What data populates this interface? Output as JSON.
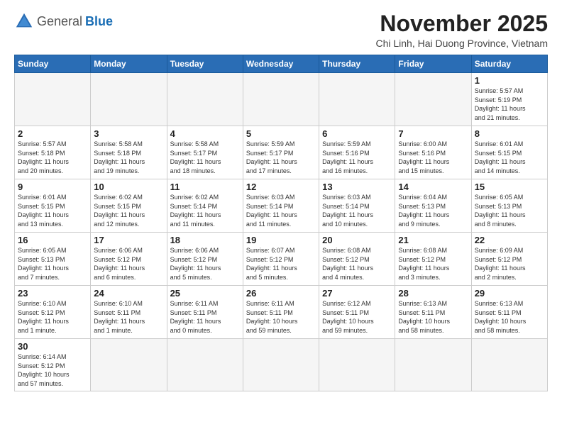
{
  "header": {
    "logo_general": "General",
    "logo_blue": "Blue",
    "month_title": "November 2025",
    "location": "Chi Linh, Hai Duong Province, Vietnam"
  },
  "weekdays": [
    "Sunday",
    "Monday",
    "Tuesday",
    "Wednesday",
    "Thursday",
    "Friday",
    "Saturday"
  ],
  "weeks": [
    [
      {
        "day": "",
        "info": ""
      },
      {
        "day": "",
        "info": ""
      },
      {
        "day": "",
        "info": ""
      },
      {
        "day": "",
        "info": ""
      },
      {
        "day": "",
        "info": ""
      },
      {
        "day": "",
        "info": ""
      },
      {
        "day": "1",
        "info": "Sunrise: 5:57 AM\nSunset: 5:19 PM\nDaylight: 11 hours\nand 21 minutes."
      }
    ],
    [
      {
        "day": "2",
        "info": "Sunrise: 5:57 AM\nSunset: 5:18 PM\nDaylight: 11 hours\nand 20 minutes."
      },
      {
        "day": "3",
        "info": "Sunrise: 5:58 AM\nSunset: 5:18 PM\nDaylight: 11 hours\nand 19 minutes."
      },
      {
        "day": "4",
        "info": "Sunrise: 5:58 AM\nSunset: 5:17 PM\nDaylight: 11 hours\nand 18 minutes."
      },
      {
        "day": "5",
        "info": "Sunrise: 5:59 AM\nSunset: 5:17 PM\nDaylight: 11 hours\nand 17 minutes."
      },
      {
        "day": "6",
        "info": "Sunrise: 5:59 AM\nSunset: 5:16 PM\nDaylight: 11 hours\nand 16 minutes."
      },
      {
        "day": "7",
        "info": "Sunrise: 6:00 AM\nSunset: 5:16 PM\nDaylight: 11 hours\nand 15 minutes."
      },
      {
        "day": "8",
        "info": "Sunrise: 6:01 AM\nSunset: 5:15 PM\nDaylight: 11 hours\nand 14 minutes."
      }
    ],
    [
      {
        "day": "9",
        "info": "Sunrise: 6:01 AM\nSunset: 5:15 PM\nDaylight: 11 hours\nand 13 minutes."
      },
      {
        "day": "10",
        "info": "Sunrise: 6:02 AM\nSunset: 5:15 PM\nDaylight: 11 hours\nand 12 minutes."
      },
      {
        "day": "11",
        "info": "Sunrise: 6:02 AM\nSunset: 5:14 PM\nDaylight: 11 hours\nand 11 minutes."
      },
      {
        "day": "12",
        "info": "Sunrise: 6:03 AM\nSunset: 5:14 PM\nDaylight: 11 hours\nand 11 minutes."
      },
      {
        "day": "13",
        "info": "Sunrise: 6:03 AM\nSunset: 5:14 PM\nDaylight: 11 hours\nand 10 minutes."
      },
      {
        "day": "14",
        "info": "Sunrise: 6:04 AM\nSunset: 5:13 PM\nDaylight: 11 hours\nand 9 minutes."
      },
      {
        "day": "15",
        "info": "Sunrise: 6:05 AM\nSunset: 5:13 PM\nDaylight: 11 hours\nand 8 minutes."
      }
    ],
    [
      {
        "day": "16",
        "info": "Sunrise: 6:05 AM\nSunset: 5:13 PM\nDaylight: 11 hours\nand 7 minutes."
      },
      {
        "day": "17",
        "info": "Sunrise: 6:06 AM\nSunset: 5:12 PM\nDaylight: 11 hours\nand 6 minutes."
      },
      {
        "day": "18",
        "info": "Sunrise: 6:06 AM\nSunset: 5:12 PM\nDaylight: 11 hours\nand 5 minutes."
      },
      {
        "day": "19",
        "info": "Sunrise: 6:07 AM\nSunset: 5:12 PM\nDaylight: 11 hours\nand 5 minutes."
      },
      {
        "day": "20",
        "info": "Sunrise: 6:08 AM\nSunset: 5:12 PM\nDaylight: 11 hours\nand 4 minutes."
      },
      {
        "day": "21",
        "info": "Sunrise: 6:08 AM\nSunset: 5:12 PM\nDaylight: 11 hours\nand 3 minutes."
      },
      {
        "day": "22",
        "info": "Sunrise: 6:09 AM\nSunset: 5:12 PM\nDaylight: 11 hours\nand 2 minutes."
      }
    ],
    [
      {
        "day": "23",
        "info": "Sunrise: 6:10 AM\nSunset: 5:12 PM\nDaylight: 11 hours\nand 1 minute."
      },
      {
        "day": "24",
        "info": "Sunrise: 6:10 AM\nSunset: 5:11 PM\nDaylight: 11 hours\nand 1 minute."
      },
      {
        "day": "25",
        "info": "Sunrise: 6:11 AM\nSunset: 5:11 PM\nDaylight: 11 hours\nand 0 minutes."
      },
      {
        "day": "26",
        "info": "Sunrise: 6:11 AM\nSunset: 5:11 PM\nDaylight: 10 hours\nand 59 minutes."
      },
      {
        "day": "27",
        "info": "Sunrise: 6:12 AM\nSunset: 5:11 PM\nDaylight: 10 hours\nand 59 minutes."
      },
      {
        "day": "28",
        "info": "Sunrise: 6:13 AM\nSunset: 5:11 PM\nDaylight: 10 hours\nand 58 minutes."
      },
      {
        "day": "29",
        "info": "Sunrise: 6:13 AM\nSunset: 5:11 PM\nDaylight: 10 hours\nand 58 minutes."
      }
    ],
    [
      {
        "day": "30",
        "info": "Sunrise: 6:14 AM\nSunset: 5:12 PM\nDaylight: 10 hours\nand 57 minutes."
      },
      {
        "day": "",
        "info": ""
      },
      {
        "day": "",
        "info": ""
      },
      {
        "day": "",
        "info": ""
      },
      {
        "day": "",
        "info": ""
      },
      {
        "day": "",
        "info": ""
      },
      {
        "day": "",
        "info": ""
      }
    ]
  ]
}
